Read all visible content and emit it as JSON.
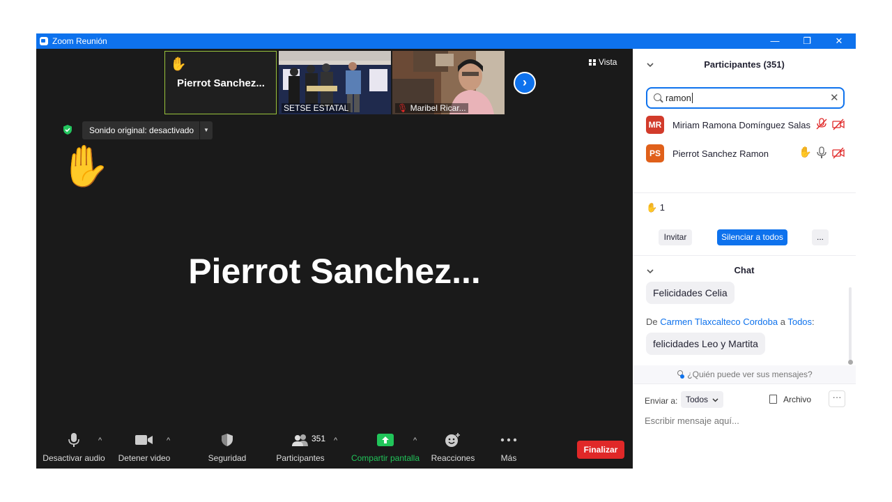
{
  "window": {
    "title": "Zoom Reunión",
    "minimize": "—",
    "maximize": "❐",
    "close": "✕"
  },
  "thumbnails": [
    {
      "name": "Pierrot  Sanchez...",
      "hand": "✋"
    },
    {
      "name": "SETSE ESTATAL"
    },
    {
      "name": "Maribel Ricar..."
    }
  ],
  "next_arrow": "›",
  "view_button": "Vista",
  "sound_pill": {
    "label": "Sonido original: desactivado",
    "caret": "▼"
  },
  "raised_hand": "✋",
  "speaker_name": "Pierrot  Sanchez...",
  "toolbar": {
    "audio": "Desactivar audio",
    "video": "Detener video",
    "security": "Seguridad",
    "participants": "Participantes",
    "participants_count": "351",
    "share": "Compartir pantalla",
    "reactions": "Reacciones",
    "more": "Más",
    "end": "Finalizar",
    "caret": "^"
  },
  "panel": {
    "title": "Participantes (351)",
    "search_value": "ramon",
    "clear": "✕",
    "participants": [
      {
        "initials": "MR",
        "name": "Miriam Ramona Domínguez Salas",
        "color": "#d23b2b"
      },
      {
        "initials": "PS",
        "name": "Pierrot Sanchez Ramon",
        "color": "#e0601a",
        "hand": "✋"
      }
    ],
    "raised_count": "✋ 1",
    "buttons": {
      "invite": "Invitar",
      "mute_all": "Silenciar a todos",
      "more": "..."
    }
  },
  "chat": {
    "title": "Chat",
    "message_1": "Felicidades Celia",
    "from_prefix": "De",
    "from_sender": "Carmen Tlaxcalteco Cordoba",
    "from_mid": "a",
    "from_target": "Todos",
    "from_suffix": ":",
    "message_2": "felicidades Leo y Martita",
    "privacy": "¿Quién puede ver sus mensajes?",
    "send_to_label": "Enviar a:",
    "send_to_value": "Todos",
    "file": "Archivo",
    "more": "···",
    "placeholder": "Escribir mensaje aquí..."
  },
  "colors": {
    "accent": "#0e72ed",
    "end": "#e02828",
    "share": "#21c55a",
    "active_border": "#9ac43c"
  }
}
